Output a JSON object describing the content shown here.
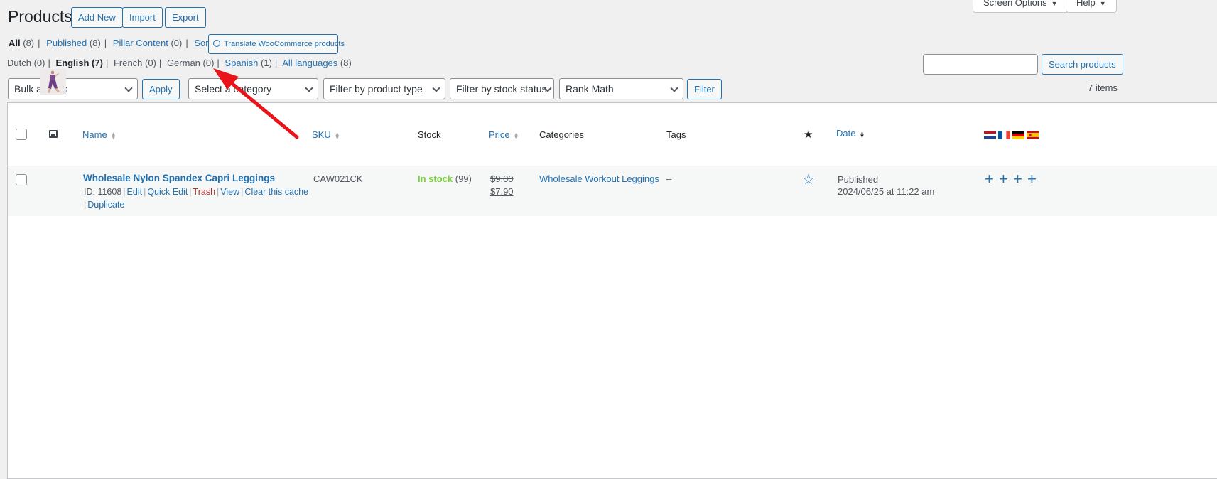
{
  "header": {
    "title": "Products",
    "add_new": "Add New",
    "import": "Import",
    "export": "Export",
    "screen_options": "Screen Options",
    "help": "Help"
  },
  "status_links": {
    "all": {
      "label": "All",
      "count": "(8)"
    },
    "published": {
      "label": "Published",
      "count": "(8)"
    },
    "pillar": {
      "label": "Pillar Content",
      "count": "(0)"
    },
    "sorting": {
      "label": "Sorting"
    },
    "translate_button": "Translate WooCommerce products"
  },
  "language_links": {
    "dutch": "Dutch (0)",
    "english": "English (7)",
    "french": "French (0)",
    "german": "German (0)",
    "spanish": {
      "label": "Spanish",
      "count": "(1)"
    },
    "all": {
      "label": "All languages",
      "count": "(8)"
    }
  },
  "search": {
    "placeholder": "",
    "button": "Search products"
  },
  "filters": {
    "bulk_actions": "Bulk actions",
    "apply": "Apply",
    "category": "Select a category",
    "product_type": "Filter by product type",
    "stock_status": "Filter by stock status",
    "rank_math": "Rank Math",
    "filter": "Filter",
    "items_count": "7 items"
  },
  "columns": {
    "name": "Name",
    "sku": "SKU",
    "stock": "Stock",
    "price": "Price",
    "categories": "Categories",
    "tags": "Tags",
    "date": "Date"
  },
  "rows": [
    {
      "name": "Wholesale Nylon Spandex Capri Leggings",
      "id_text": "ID: 11608",
      "actions": {
        "edit": "Edit",
        "quick_edit": "Quick Edit",
        "trash": "Trash",
        "view": "View",
        "clear_cache": "Clear this cache",
        "duplicate": "Duplicate"
      },
      "sku": "CAW021CK",
      "stock_status": "In stock",
      "stock_count": "(99)",
      "price_old": "$9.00",
      "price_new": "$7.90",
      "category": "Wholesale Workout Leggings",
      "tags": "–",
      "date_status": "Published",
      "date": "2024/06/25 at 11:22 am"
    }
  ],
  "colors": {
    "link": "#2271b1",
    "instock": "#7ad03a",
    "trash": "#b32d2e",
    "arrow": "#e8141a"
  },
  "language_flags": [
    "nl-flag-icon",
    "fr-flag-icon",
    "de-flag-icon",
    "es-flag-icon"
  ]
}
